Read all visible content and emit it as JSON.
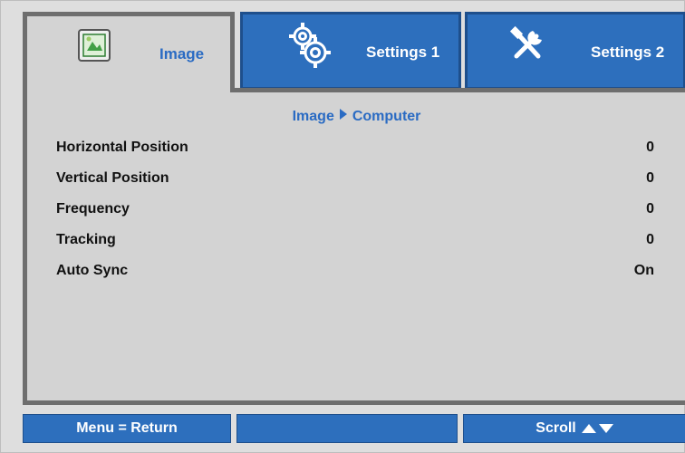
{
  "tabs": [
    {
      "label": "Image",
      "icon": "image-icon",
      "active": true
    },
    {
      "label": "Settings 1",
      "icon": "gears-icon",
      "active": false
    },
    {
      "label": "Settings 2",
      "icon": "tools-icon",
      "active": false
    }
  ],
  "breadcrumb": {
    "parent": "Image",
    "child": "Computer"
  },
  "items": [
    {
      "label": "Horizontal Position",
      "value": "0"
    },
    {
      "label": "Vertical Position",
      "value": "0"
    },
    {
      "label": "Frequency",
      "value": "0"
    },
    {
      "label": "Tracking",
      "value": "0"
    },
    {
      "label": "Auto Sync",
      "value": "On"
    }
  ],
  "footer": {
    "left": "Menu = Return",
    "middle": "",
    "right": "Scroll"
  },
  "colors": {
    "accent": "#2a6bc3",
    "tab_blue": "#2d6fbd",
    "panel": "#d3d3d3",
    "border": "#6e6e6e"
  }
}
